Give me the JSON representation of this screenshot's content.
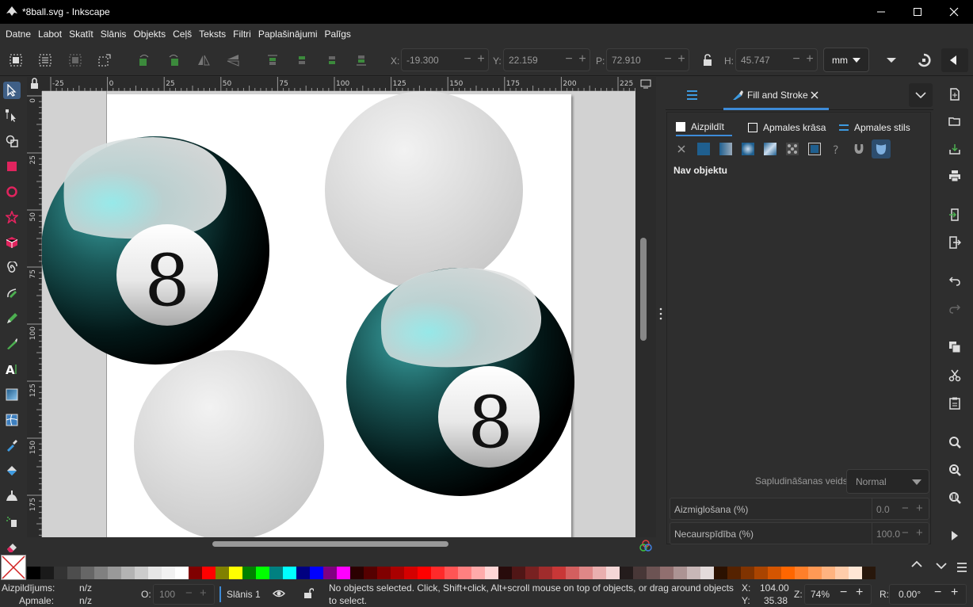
{
  "window": {
    "title": "*8ball.svg - Inkscape"
  },
  "menu": [
    "Datne",
    "Labot",
    "Skatīt",
    "Slānis",
    "Objekts",
    "Ceļš",
    "Teksts",
    "Filtri",
    "Paplašinājumi",
    "Palīgs"
  ],
  "toolbar": {
    "x_label": "X:",
    "x_value": "-19.300",
    "y_label": "Y:",
    "y_value": "22.159",
    "w_label": "P:",
    "w_value": "72.910",
    "h_label": "H:",
    "h_value": "45.747",
    "unit": "mm"
  },
  "ruler": {
    "h_labels": [
      "-25",
      "0",
      "25",
      "50",
      "75",
      "100",
      "125",
      "150",
      "175",
      "200",
      "225"
    ],
    "v_labels": [
      "0",
      "25",
      "50",
      "75",
      "100",
      "125",
      "150",
      "175"
    ]
  },
  "canvas": {
    "ball1_number": "8",
    "ball2_number": "8"
  },
  "dock": {
    "tab_title": "Fill and Stroke",
    "subtabs": [
      "Aizpildīt",
      "Apmales krāsa",
      "Apmales stils"
    ],
    "no_object": "Nav objektu",
    "blend_label": "Sapludināšanas veids:",
    "blend_value": "Normal",
    "blur_label": "Aizmiglošana (%)",
    "blur_value": "0.0",
    "opacity_label": "Necaurspīdība (%)",
    "opacity_value": "100.0"
  },
  "palette": [
    "#000000",
    "#1a1a1a",
    "#333333",
    "#4d4d4d",
    "#666666",
    "#808080",
    "#999999",
    "#b3b3b3",
    "#cccccc",
    "#e6e6e6",
    "#f2f2f2",
    "#ffffff",
    "#800000",
    "#ff0000",
    "#808000",
    "#ffff00",
    "#008000",
    "#00ff00",
    "#008080",
    "#00ffff",
    "#000080",
    "#0000ff",
    "#800080",
    "#ff00ff",
    "#2b0000",
    "#550000",
    "#800000",
    "#aa0000",
    "#d40000",
    "#ff0000",
    "#ff2a2a",
    "#ff5555",
    "#ff8080",
    "#ffaaaa",
    "#ffd5d5",
    "#280b0b",
    "#501616",
    "#782121",
    "#a02c2c",
    "#c83737",
    "#d35f5f",
    "#de8787",
    "#e9afaf",
    "#f4d7d7",
    "#241c1c",
    "#483737",
    "#6c5353",
    "#916f6f",
    "#ac9393",
    "#c8b7b7",
    "#e3dbdb",
    "#2b1100",
    "#552200",
    "#803300",
    "#aa4400",
    "#d45500",
    "#ff6600",
    "#ff7f2a",
    "#ff9955",
    "#ffb380",
    "#ffccaa",
    "#ffe6d5",
    "#28170b"
  ],
  "status": {
    "fill_label": "Aizpildījums:",
    "fill_value": "n/z",
    "stroke_label": "Apmale:",
    "stroke_value": "n/z",
    "opacity_label": "O:",
    "opacity_value": "100",
    "layer": "Slānis 1",
    "message_line1": "No objects selected. Click, Shift+click, Alt+scroll mouse on top of objects, or drag around objects",
    "message_line2": "to select.",
    "x_label": "X:",
    "x_value": "104.00",
    "y_label": "Y:",
    "y_value": "35.38",
    "zoom_label": "Z:",
    "zoom_value": "74%",
    "rot_label": "R:",
    "rot_value": "0.00°"
  }
}
